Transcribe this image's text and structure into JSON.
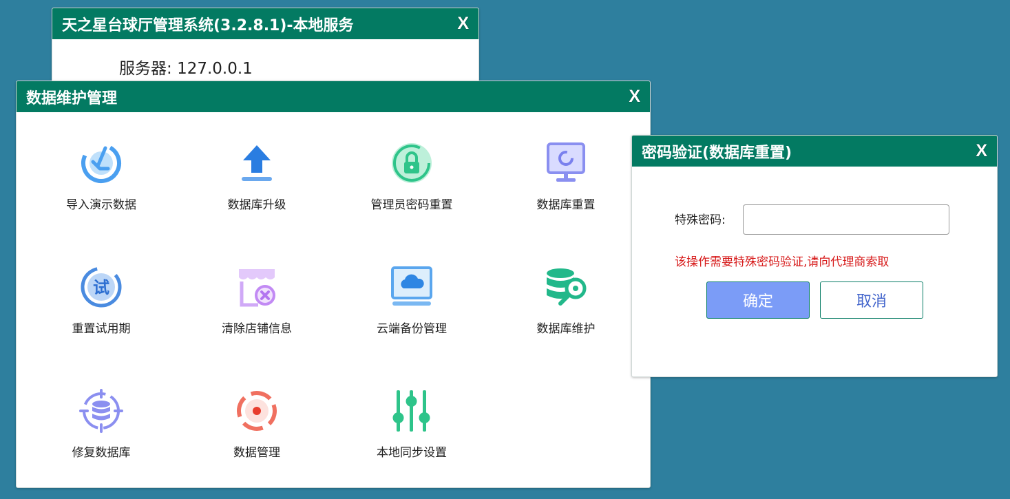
{
  "main_window": {
    "title": "天之星台球厅管理系统(3.2.8.1)-本地服务",
    "close": "X",
    "server_label": "服务器: ",
    "server_value": "127.0.0.1"
  },
  "data_window": {
    "title": "数据维护管理",
    "close": "X",
    "tiles": [
      {
        "label": "导入演示数据",
        "icon": "import-download-icon",
        "color": "#4a9ff0"
      },
      {
        "label": "数据库升级",
        "icon": "upload-arrow-icon",
        "color": "#2a7de1"
      },
      {
        "label": "管理员密码重置",
        "icon": "lock-reset-icon",
        "color": "#2ec48a"
      },
      {
        "label": "数据库重置",
        "icon": "monitor-refresh-icon",
        "color": "#8a8ff0"
      },
      {
        "label": "重置试用期",
        "icon": "trial-reset-icon",
        "color": "#4a8be0"
      },
      {
        "label": "清除店铺信息",
        "icon": "store-clear-icon",
        "color": "#c79af5"
      },
      {
        "label": "云端备份管理",
        "icon": "cloud-laptop-icon",
        "color": "#3a90e6"
      },
      {
        "label": "数据库维护",
        "icon": "database-wrench-icon",
        "color": "#22b88a"
      },
      {
        "label": "修复数据库",
        "icon": "database-repair-icon",
        "color": "#8b8ff0"
      },
      {
        "label": "数据管理",
        "icon": "data-target-icon",
        "color": "#f07060"
      },
      {
        "label": "本地同步设置",
        "icon": "sliders-icon",
        "color": "#2ec48a"
      }
    ]
  },
  "password_window": {
    "title": "密码验证(数据库重置)",
    "close": "X",
    "field_label": "特殊密码:",
    "field_value": "",
    "warning": "该操作需要特殊密码验证,请向代理商索取",
    "ok_label": "确定",
    "cancel_label": "取消"
  }
}
